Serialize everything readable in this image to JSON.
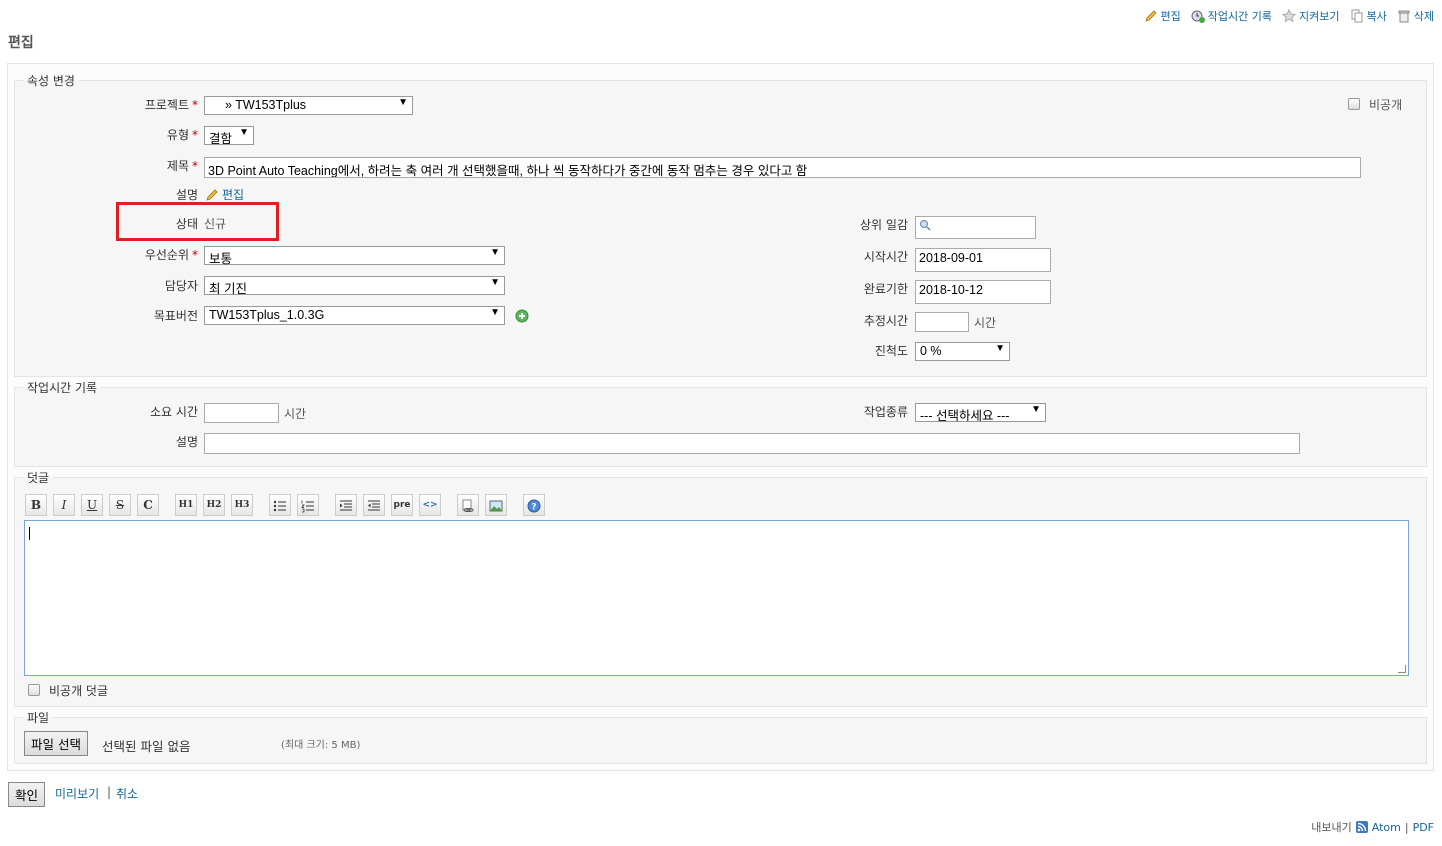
{
  "contextual": {
    "edit": "편집",
    "log_time": "작업시간 기록",
    "watch": "지켜보기",
    "copy": "복사",
    "delete": "삭제"
  },
  "page_title": "편집",
  "attributes": {
    "legend": "속성 변경",
    "project_label": "프로젝트",
    "project_value": "» TW153Tplus",
    "private_label": "비공개",
    "tracker_label": "유형",
    "tracker_value": "결함",
    "subject_label": "제목",
    "subject_value": "3D Point Auto Teaching에서, 하려는 축 여러 개 선택했을때, 하나 씩 동작하다가 중간에 동작 멈추는 경우 있다고 함",
    "description_label": "설명",
    "description_edit": "편집",
    "status_label": "상태",
    "status_value": "신규",
    "priority_label": "우선순위",
    "priority_value": "보통",
    "assignee_label": "담당자",
    "assignee_value": "최 기진",
    "version_label": "목표버전",
    "version_value": "TW153Tplus_1.0.3G",
    "parent_label": "상위 일감",
    "start_label": "시작시간",
    "start_value": "2018-09-01",
    "due_label": "완료기한",
    "due_value": "2018-10-12",
    "estimated_label": "추정시간",
    "estimated_unit": "시간",
    "done_label": "진척도",
    "done_value": "0 %"
  },
  "time_entry": {
    "legend": "작업시간 기록",
    "hours_label": "소요 시간",
    "hours_unit": "시간",
    "activity_label": "작업종류",
    "activity_value": "--- 선택하세요 ---",
    "comment_label": "설명"
  },
  "notes": {
    "legend": "덧글",
    "toolbar": [
      "B",
      "I",
      "U",
      "S",
      "C",
      "H1",
      "H2",
      "H3",
      "pre",
      "<>"
    ],
    "private_notes_label": "비공개 덧글"
  },
  "files": {
    "legend": "파일",
    "choose_button": "파일 선택",
    "no_file": "선택된 파일 없음",
    "max_size": "(최대 크기: 5 MB)"
  },
  "actions": {
    "submit": "확인",
    "preview": "미리보기",
    "separator": "|",
    "cancel": "취소"
  },
  "footer": {
    "export_label": "내보내기",
    "atom": "Atom",
    "separator": "|",
    "pdf": "PDF"
  }
}
